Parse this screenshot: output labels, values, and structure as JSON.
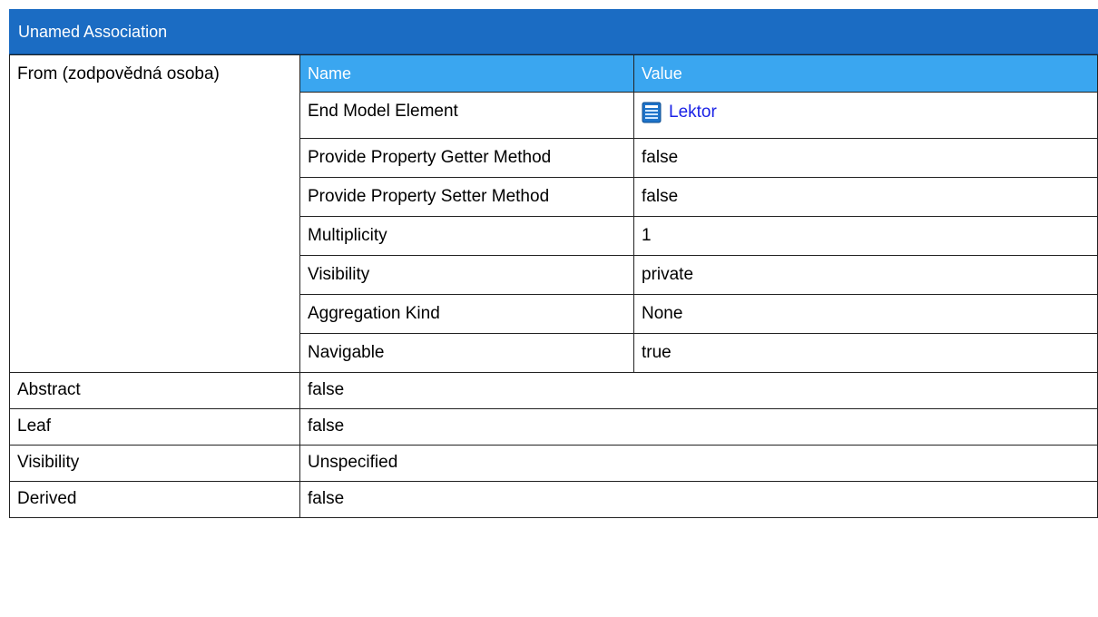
{
  "header": {
    "title": "Unamed Association"
  },
  "from": {
    "label": "From (zodpovědná osoba)",
    "table": {
      "col_name": "Name",
      "col_value": "Value",
      "end_model_element": {
        "name": "End Model Element",
        "value": "Lektor",
        "icon": "class-document-icon"
      },
      "rows": [
        {
          "name": "Provide Property Getter Method",
          "value": "false"
        },
        {
          "name": "Provide Property Setter Method",
          "value": "false"
        },
        {
          "name": "Multiplicity",
          "value": "1"
        },
        {
          "name": "Visibility",
          "value": "private"
        },
        {
          "name": "Aggregation Kind",
          "value": "None"
        },
        {
          "name": "Navigable",
          "value": "true"
        }
      ]
    }
  },
  "properties": [
    {
      "label": "Abstract",
      "value": "false"
    },
    {
      "label": "Leaf",
      "value": "false"
    },
    {
      "label": "Visibility",
      "value": "Unspecified"
    },
    {
      "label": "Derived",
      "value": "false"
    }
  ],
  "colors": {
    "title_bar": "#1b6cc3",
    "table_header": "#3aa6f0",
    "link": "#1a22e6"
  }
}
